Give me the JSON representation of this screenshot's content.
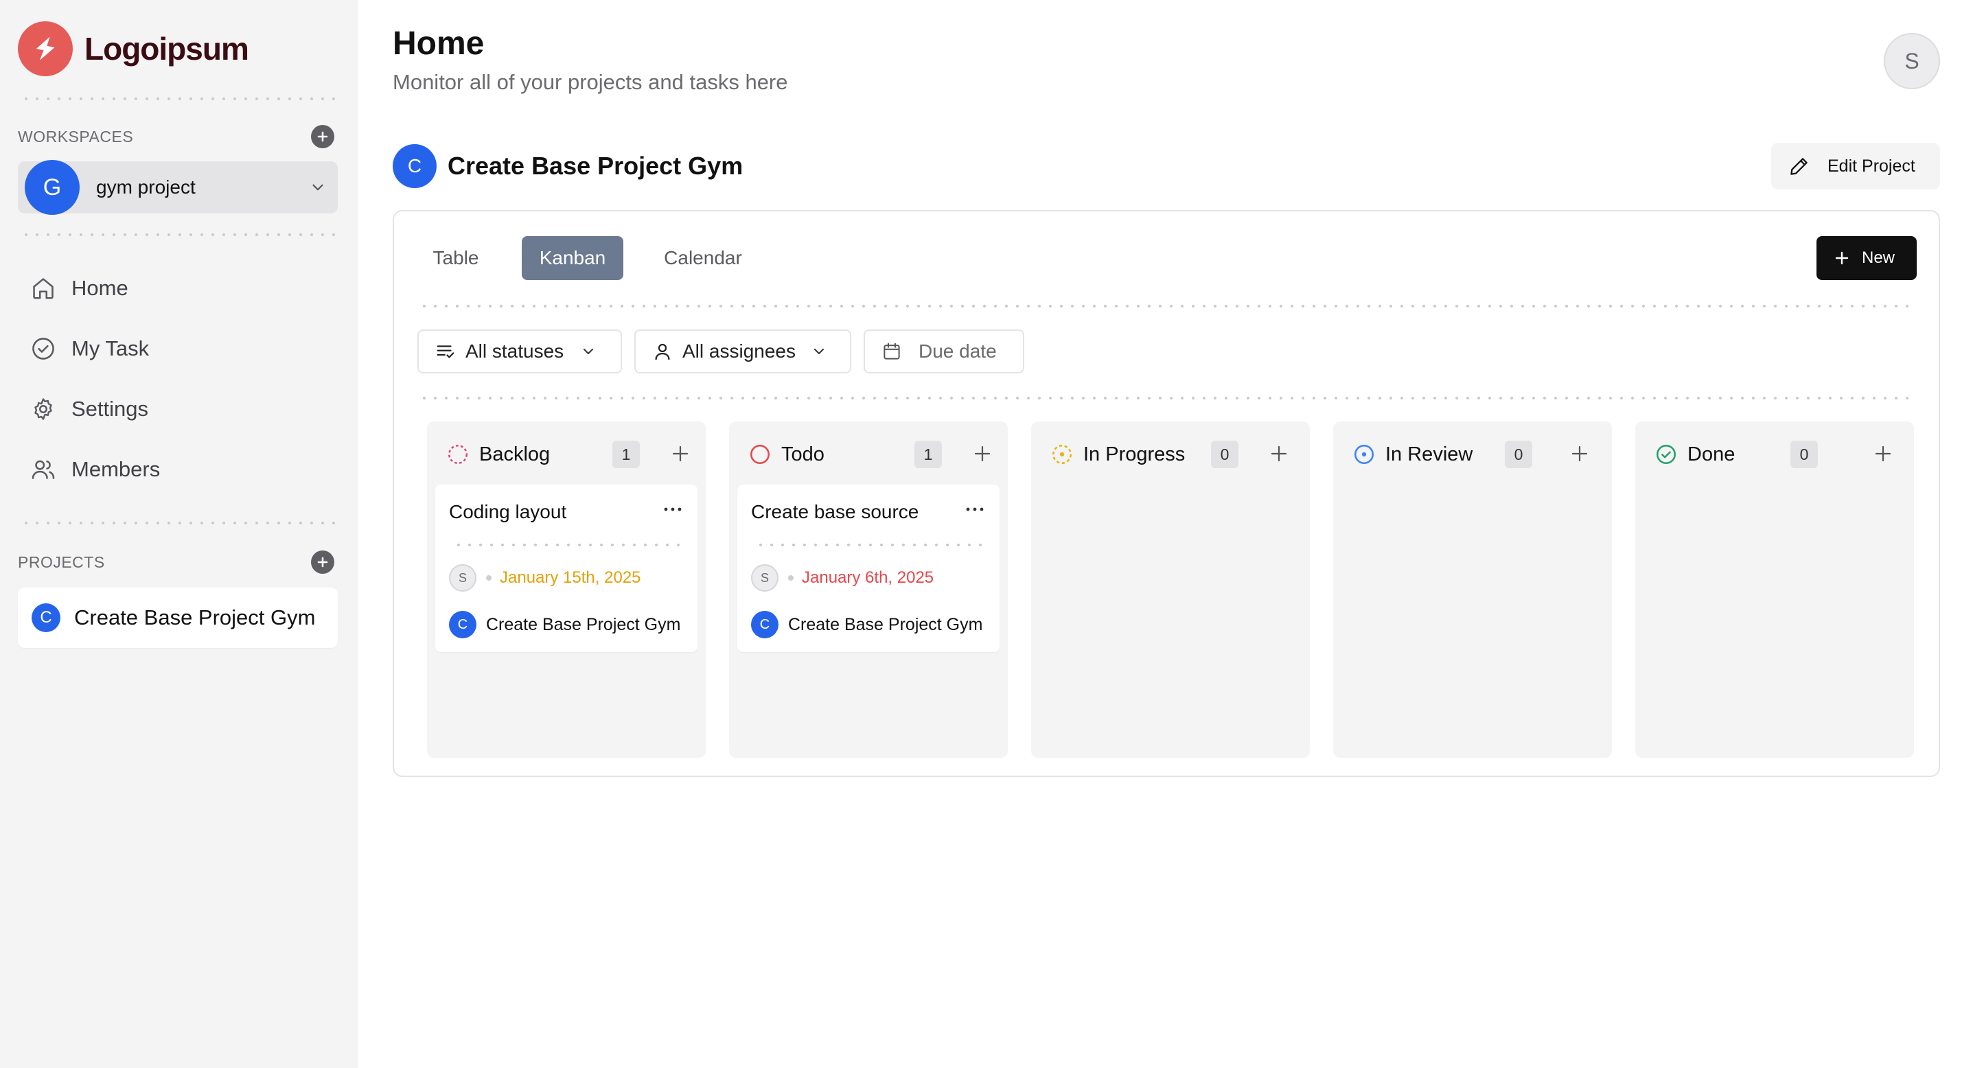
{
  "brand": {
    "name": "Logoipsum",
    "color": "#e45b57"
  },
  "sidebar": {
    "workspaces_label": "WORKSPACES",
    "workspace": {
      "initial": "G",
      "name": "gym project"
    },
    "nav": [
      {
        "label": "Home",
        "icon": "home-icon"
      },
      {
        "label": "My Task",
        "icon": "check-circle-icon"
      },
      {
        "label": "Settings",
        "icon": "gear-icon"
      },
      {
        "label": "Members",
        "icon": "users-icon"
      }
    ],
    "projects_label": "PROJECTS",
    "projects": [
      {
        "initial": "C",
        "name": "Create Base Project Gym"
      }
    ]
  },
  "header": {
    "title": "Home",
    "subtitle": "Monitor all of your projects and tasks here",
    "user_initial": "S"
  },
  "project": {
    "initial": "C",
    "title": "Create Base Project Gym",
    "edit_label": "Edit Project"
  },
  "views": {
    "tabs": [
      {
        "label": "Table",
        "active": false
      },
      {
        "label": "Kanban",
        "active": true
      },
      {
        "label": "Calendar",
        "active": false
      }
    ],
    "new_label": "New"
  },
  "filters": {
    "status": "All statuses",
    "assignee": "All assignees",
    "due_date": "Due date"
  },
  "columns": [
    {
      "title": "Backlog",
      "count": "1",
      "status_color": "#e0457b",
      "cards": [
        {
          "title": "Coding layout",
          "assignee": "S",
          "due": "January 15th, 2025",
          "due_color": "#e3a008",
          "project_initial": "C",
          "project": "Create Base Project Gym"
        }
      ]
    },
    {
      "title": "Todo",
      "count": "1",
      "status_color": "#e5484d",
      "cards": [
        {
          "title": "Create base source",
          "assignee": "S",
          "due": "January 6th, 2025",
          "due_color": "#e5484d",
          "project_initial": "C",
          "project": "Create Base Project Gym"
        }
      ]
    },
    {
      "title": "In Progress",
      "count": "0",
      "status_color": "#eab308",
      "cards": []
    },
    {
      "title": "In Review",
      "count": "0",
      "status_color": "#3b82f6",
      "cards": []
    },
    {
      "title": "Done",
      "count": "0",
      "status_color": "#22a06b",
      "cards": []
    }
  ]
}
